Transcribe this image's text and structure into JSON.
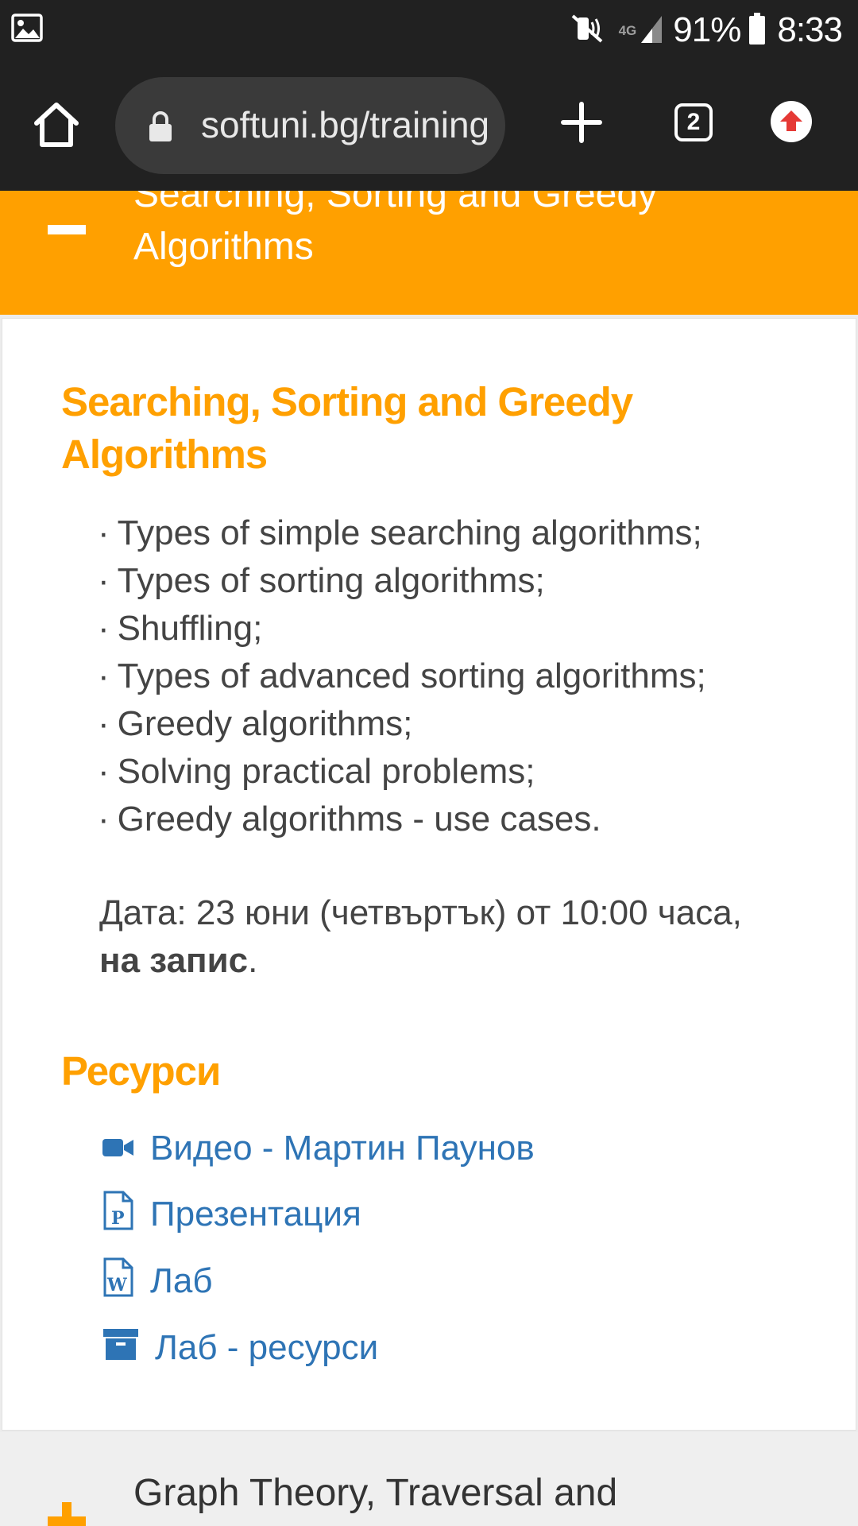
{
  "status_bar": {
    "network": "4G",
    "battery_percent": "91%",
    "time": "8:33",
    "icons": [
      "gallery-icon",
      "mute-icon",
      "signal-icon",
      "battery-icon"
    ]
  },
  "browser": {
    "url": "softuni.bg/training",
    "tab_count": "2",
    "icons": [
      "home-icon",
      "lock-icon",
      "plus-icon",
      "tabs-icon",
      "update-icon"
    ]
  },
  "accordion": {
    "open_section_title": "Searching, Sorting and Greedy Algorithms",
    "next_section_title": "Graph Theory, Traversal and",
    "accent_color": "#ffa000"
  },
  "lesson": {
    "title": "Searching, Sorting and Greedy Algorithms",
    "topics": [
      "Types of simple searching algorithms;",
      "Types of sorting algorithms;",
      "Shuffling;",
      "Types of advanced sorting algorithms;",
      "Greedy algorithms;",
      "Solving practical problems;",
      "Greedy algorithms - use cases."
    ],
    "date_text": "Дата: 23 юни (четвъртък) от 10:00 часа,",
    "recording_label": "на запис",
    "recording_suffix": "."
  },
  "resources": {
    "title": "Ресурси",
    "link_color": "#2e74b5",
    "items": [
      {
        "label": "Видео - Мартин Паунов",
        "icon": "video-camera-icon"
      },
      {
        "label": "Презентация",
        "icon": "powerpoint-file-icon"
      },
      {
        "label": "Лаб",
        "icon": "word-file-icon"
      },
      {
        "label": "Лаб - ресурси",
        "icon": "archive-box-icon"
      }
    ]
  }
}
